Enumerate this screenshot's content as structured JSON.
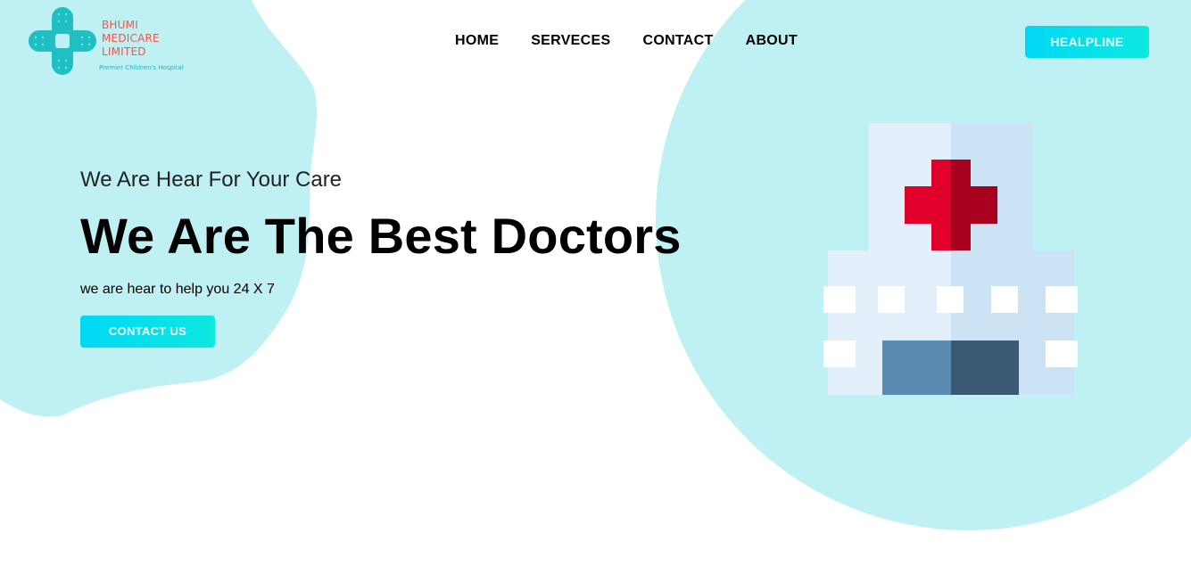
{
  "logo": {
    "name_lines": [
      "BHUMI",
      "MEDICARE",
      "LIMITED"
    ],
    "tagline": "Premier Children's Hospital",
    "icon": "bandage-cross-icon"
  },
  "nav": {
    "items": [
      {
        "label": "HOME"
      },
      {
        "label": "SERVECES"
      },
      {
        "label": "CONTACT"
      },
      {
        "label": "ABOUT"
      }
    ]
  },
  "header": {
    "helpline_label": "HEALPLINE"
  },
  "hero": {
    "subtitle": "We Are Hear For Your Care",
    "title": "We Are The Best Doctors",
    "text": "we are hear to help you 24 X 7",
    "cta_label": "CONTACT US"
  },
  "illustration": {
    "icon": "hospital-building-icon"
  },
  "colors": {
    "accent": "#00d8f5",
    "blob": "#bff0f4",
    "logo_text": "#e8594f",
    "cross_red": "#e0002b"
  }
}
